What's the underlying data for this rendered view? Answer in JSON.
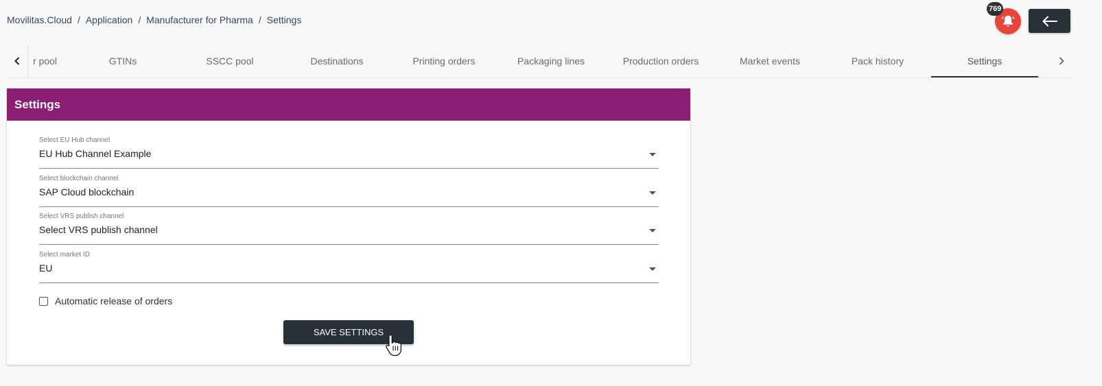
{
  "breadcrumb": [
    "Movilitas.Cloud",
    "Application",
    "Manufacturer for Pharma",
    "Settings"
  ],
  "notifications": {
    "count": "769",
    "icon": "bell-icon",
    "color": "#e8443a"
  },
  "back_button": {
    "icon": "arrow-left-icon"
  },
  "tabs": [
    {
      "label": "r pool"
    },
    {
      "label": "GTINs"
    },
    {
      "label": "SSCC pool"
    },
    {
      "label": "Destinations"
    },
    {
      "label": "Printing orders"
    },
    {
      "label": "Packaging lines"
    },
    {
      "label": "Production orders"
    },
    {
      "label": "Market events"
    },
    {
      "label": "Pack history"
    },
    {
      "label": "Settings",
      "active": true
    }
  ],
  "card": {
    "title": "Settings",
    "header_color": "#8b1e73",
    "fields": [
      {
        "label": "Select EU Hub channel",
        "value": "EU Hub Channel Example"
      },
      {
        "label": "Select blockchain channel",
        "value": "SAP Cloud blockchain"
      },
      {
        "label": "Select VRS publish channel",
        "value": "Select VRS publish channel"
      },
      {
        "label": "Select market ID",
        "value": "EU"
      }
    ],
    "checkbox": {
      "label": "Automatic release of orders",
      "checked": false
    },
    "save_label": "SAVE SETTINGS"
  }
}
